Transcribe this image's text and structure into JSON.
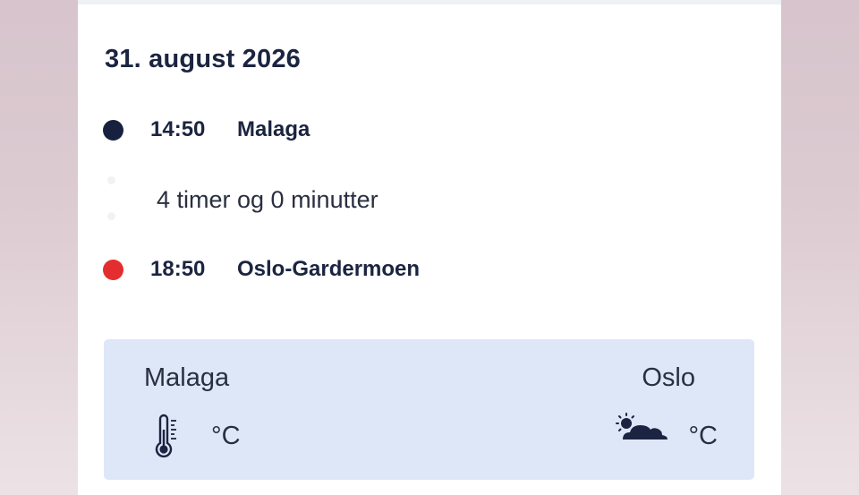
{
  "flight": {
    "date": "31. august 2026",
    "departure": {
      "time": "14:50",
      "place": "Malaga",
      "dot_color": "#17213f"
    },
    "duration": "4 timer og 0 minutter",
    "arrival": {
      "time": "18:50",
      "place": "Oslo-Gardermoen",
      "dot_color": "#e42d2f"
    }
  },
  "weather": {
    "origin": {
      "city": "Malaga",
      "unit": "°C",
      "icon": "thermometer-icon"
    },
    "destination": {
      "city": "Oslo",
      "unit": "°C",
      "icon": "partly-cloudy-icon"
    }
  },
  "colors": {
    "panel_bg": "#dde7f8",
    "text": "#1b2440"
  }
}
